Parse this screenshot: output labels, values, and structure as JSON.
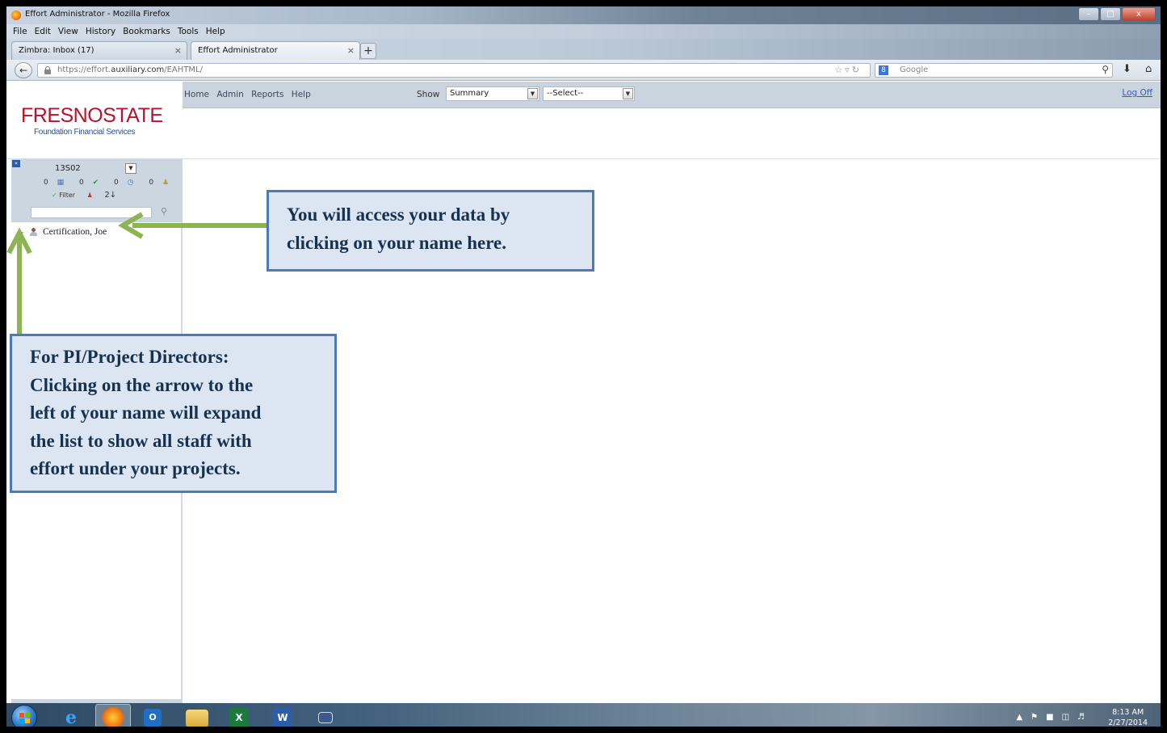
{
  "window": {
    "title": "Effort Administrator - Mozilla Firefox",
    "controls": [
      "–",
      "□",
      "x"
    ]
  },
  "menu": [
    "File",
    "Edit",
    "View",
    "History",
    "Bookmarks",
    "Tools",
    "Help"
  ],
  "tabs": [
    {
      "label": "Zimbra: Inbox (17)",
      "close": "×"
    },
    {
      "label": "Effort Administrator",
      "close": "×"
    }
  ],
  "newtab_label": "+",
  "address": {
    "url_prefix": "https://effort.",
    "url_domain": "auxiliary.com",
    "url_suffix": "/EAHTML/",
    "search_placeholder": "Google",
    "search_engine_letter": "8"
  },
  "app": {
    "logo_main": "FRESNOSTATE",
    "logo_sub": "Foundation Financial Services",
    "nav_links": [
      "Home",
      "Admin",
      "Reports",
      "Help"
    ],
    "show_label": "Show",
    "show_value": "Summary",
    "select_value": "--Select--",
    "logoff": "Log Off"
  },
  "sidebar": {
    "collapse_label": "«",
    "account": "13S02",
    "status_counts": [
      "0",
      "0",
      "0",
      "0"
    ],
    "filter_label": "Filter",
    "sort_label": "2↓",
    "tree": [
      {
        "name": "Certification, Joe"
      }
    ]
  },
  "callouts": {
    "name_hint": [
      "You will access your data by",
      "clicking on your name here."
    ],
    "pi_hint": [
      "For PI/Project Directors:",
      "Clicking on the arrow to the",
      "left of your name will expand",
      "the list to show all staff with",
      "effort under your projects."
    ]
  },
  "taskbar": {
    "time": "8:13 AM",
    "date": "2/27/2014"
  },
  "colors": {
    "callout_bg": "#dce6f2",
    "callout_border": "#4d7ab6",
    "arrow": "#8db453",
    "logo_red": "#b8122e"
  }
}
